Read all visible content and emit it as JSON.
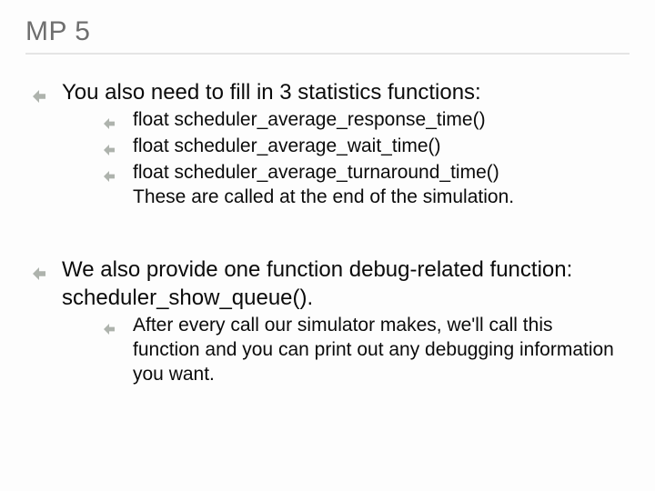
{
  "title": "MP 5",
  "content": {
    "b1": {
      "text": "You also need to fill in 3 statistics functions:",
      "subs": {
        "s1": "float scheduler_average_response_time()",
        "s2": "float scheduler_average_wait_time()",
        "s3": "float scheduler_average_turnaround_time()",
        "s3_cont": "These are called at the end of the simulation."
      }
    },
    "b2": {
      "text": "We also provide one function debug-related function: scheduler_show_queue().",
      "subs": {
        "s1": "After every call our simulator makes, we'll call this function and you can print out any debugging information you want."
      }
    }
  }
}
